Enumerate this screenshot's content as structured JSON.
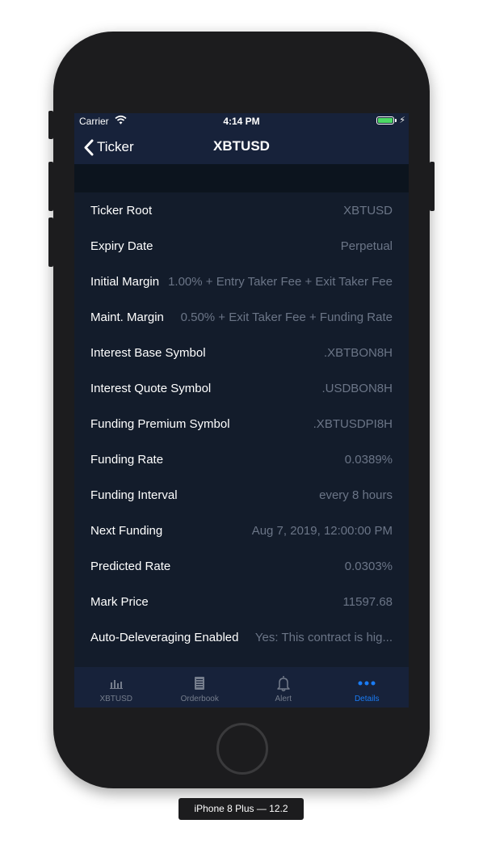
{
  "status_bar": {
    "carrier": "Carrier",
    "time": "4:14 PM"
  },
  "nav": {
    "back_label": "Ticker",
    "title": "XBTUSD"
  },
  "details": [
    {
      "label": "Ticker Root",
      "value": "XBTUSD"
    },
    {
      "label": "Expiry Date",
      "value": "Perpetual"
    },
    {
      "label": "Initial Margin",
      "value": "1.00% + Entry Taker Fee + Exit Taker Fee"
    },
    {
      "label": "Maint. Margin",
      "value": "0.50% + Exit Taker Fee + Funding Rate"
    },
    {
      "label": "Interest Base Symbol",
      "value": ".XBTBON8H"
    },
    {
      "label": "Interest Quote Symbol",
      "value": ".USDBON8H"
    },
    {
      "label": "Funding Premium Symbol",
      "value": ".XBTUSDPI8H"
    },
    {
      "label": "Funding Rate",
      "value": "0.0389%"
    },
    {
      "label": "Funding Interval",
      "value": "every 8 hours"
    },
    {
      "label": "Next Funding",
      "value": "Aug 7, 2019, 12:00:00 PM"
    },
    {
      "label": "Predicted Rate",
      "value": "0.0303%"
    },
    {
      "label": "Mark Price",
      "value": "11597.68"
    },
    {
      "label": "Auto-Deleveraging Enabled",
      "value": "Yes: This contract is hig..."
    }
  ],
  "tabs": [
    {
      "label": "XBTUSD",
      "icon": "bar-chart-icon",
      "active": false
    },
    {
      "label": "Orderbook",
      "icon": "orderbook-icon",
      "active": false
    },
    {
      "label": "Alert",
      "icon": "bell-icon",
      "active": false
    },
    {
      "label": "Details",
      "icon": "more-dots-icon",
      "active": true
    }
  ],
  "device_caption": "iPhone 8 Plus — 12.2",
  "colors": {
    "background": "#131c2b",
    "bar": "#17223a",
    "section_header": "#0c141e",
    "value_text": "#6b7587",
    "active_tab": "#1a7cf5",
    "inactive_tab": "#757d8c",
    "battery": "#4cd964"
  }
}
